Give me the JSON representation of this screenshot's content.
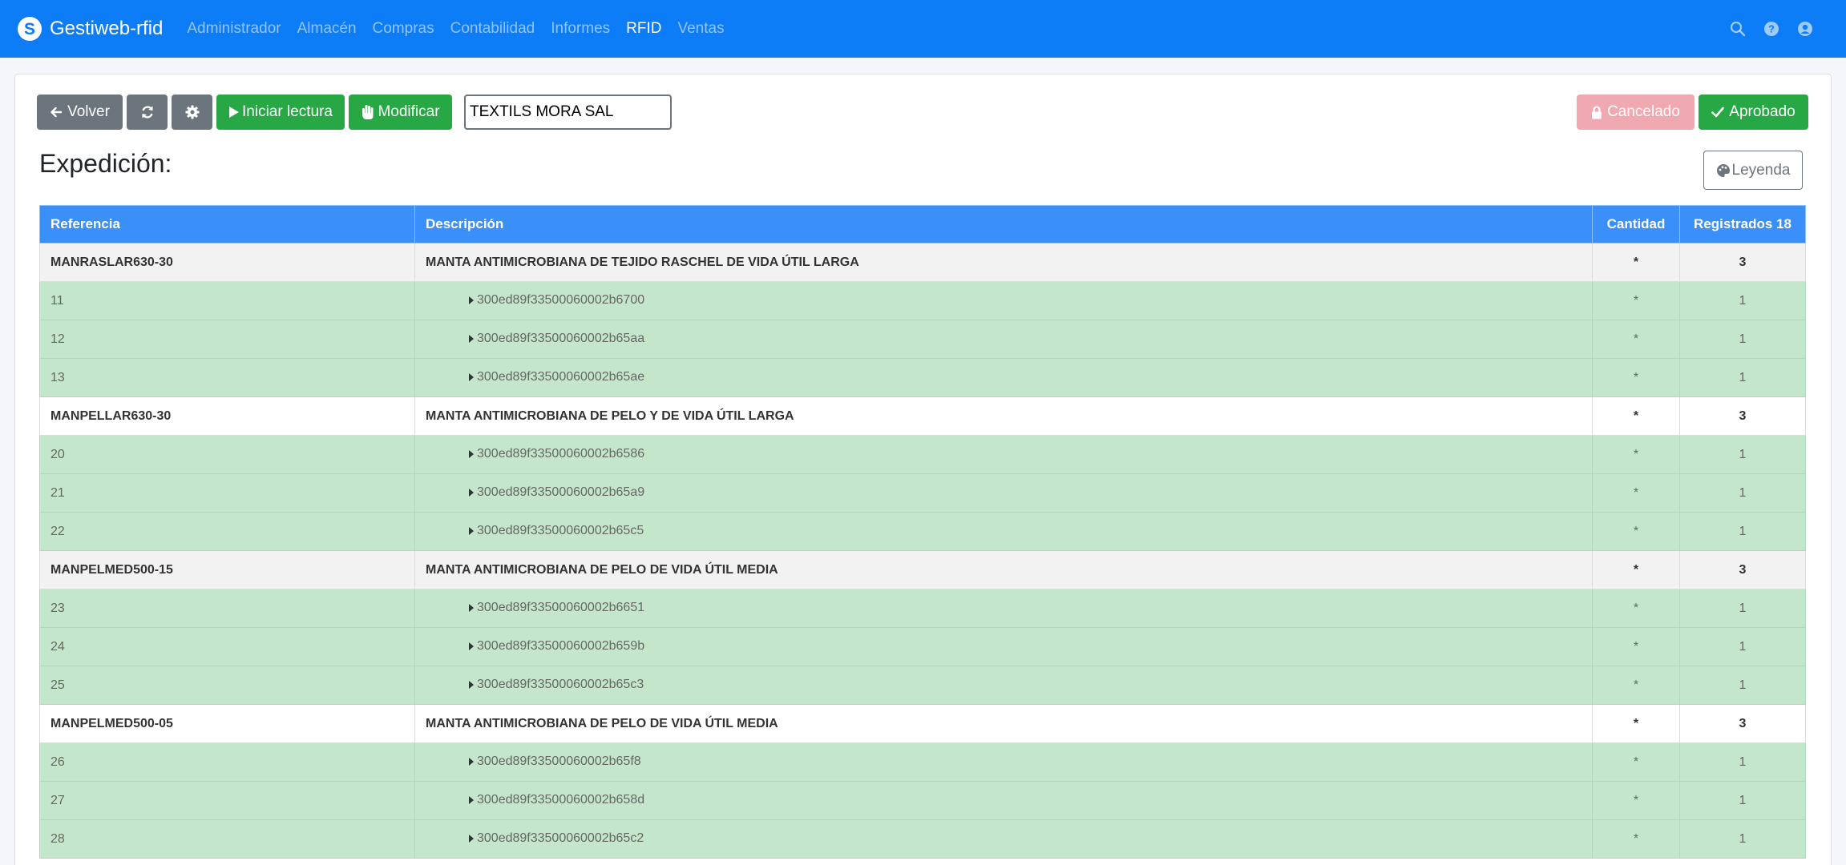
{
  "app": {
    "brand_letter": "S",
    "name": "Gestiweb-rfid"
  },
  "nav": {
    "items": [
      "Administrador",
      "Almacén",
      "Compras",
      "Contabilidad",
      "Informes",
      "RFID",
      "Ventas"
    ],
    "active": "RFID",
    "icons": [
      "search-icon",
      "help-icon",
      "user-icon"
    ]
  },
  "toolbar": {
    "back_label": "Volver",
    "refresh_icon": "refresh-icon",
    "settings_icon": "gear-icon",
    "start_read_label": "Iniciar lectura",
    "modify_label": "Modificar",
    "client_value": "TEXTILS MORA SAL",
    "cancelled_label": "Cancelado",
    "approved_label": "Aprobado"
  },
  "section": {
    "title": "Expedición:",
    "legend_label": "Leyenda"
  },
  "table": {
    "headers": {
      "reference": "Referencia",
      "description": "Descripción",
      "quantity": "Cantidad",
      "registered": "Registrados 18"
    },
    "groups": [
      {
        "reference": "MANRASLAR630-30",
        "description": "MANTA ANTIMICROBIANA DE TEJIDO RASCHEL DE VIDA ÚTIL LARGA",
        "quantity": "*",
        "registered": "3",
        "items": [
          {
            "num": "11",
            "epc": "300ed89f33500060002b6700",
            "quantity": "*",
            "registered": "1"
          },
          {
            "num": "12",
            "epc": "300ed89f33500060002b65aa",
            "quantity": "*",
            "registered": "1"
          },
          {
            "num": "13",
            "epc": "300ed89f33500060002b65ae",
            "quantity": "*",
            "registered": "1"
          }
        ]
      },
      {
        "reference": "MANPELLAR630-30",
        "description": "MANTA ANTIMICROBIANA DE PELO Y DE VIDA ÚTIL LARGA",
        "quantity": "*",
        "registered": "3",
        "items": [
          {
            "num": "20",
            "epc": "300ed89f33500060002b6586",
            "quantity": "*",
            "registered": "1"
          },
          {
            "num": "21",
            "epc": "300ed89f33500060002b65a9",
            "quantity": "*",
            "registered": "1"
          },
          {
            "num": "22",
            "epc": "300ed89f33500060002b65c5",
            "quantity": "*",
            "registered": "1"
          }
        ]
      },
      {
        "reference": "MANPELMED500-15",
        "description": "MANTA ANTIMICROBIANA DE PELO DE VIDA ÚTIL MEDIA",
        "quantity": "*",
        "registered": "3",
        "items": [
          {
            "num": "23",
            "epc": "300ed89f33500060002b6651",
            "quantity": "*",
            "registered": "1"
          },
          {
            "num": "24",
            "epc": "300ed89f33500060002b659b",
            "quantity": "*",
            "registered": "1"
          },
          {
            "num": "25",
            "epc": "300ed89f33500060002b65c3",
            "quantity": "*",
            "registered": "1"
          }
        ]
      },
      {
        "reference": "MANPELMED500-05",
        "description": "MANTA ANTIMICROBIANA DE PELO DE VIDA ÚTIL MEDIA",
        "quantity": "*",
        "registered": "3",
        "items": [
          {
            "num": "26",
            "epc": "300ed89f33500060002b65f8",
            "quantity": "*",
            "registered": "1"
          },
          {
            "num": "27",
            "epc": "300ed89f33500060002b658d",
            "quantity": "*",
            "registered": "1"
          },
          {
            "num": "28",
            "epc": "300ed89f33500060002b65c2",
            "quantity": "*",
            "registered": "1"
          }
        ]
      }
    ]
  },
  "colors": {
    "primary": "#0d7cf7",
    "table_header": "#3b8ff8",
    "success": "#28a745",
    "secondary": "#6c757d",
    "row_read": "#c4e6ca",
    "cancel_disabled": "#f1a9b1"
  }
}
